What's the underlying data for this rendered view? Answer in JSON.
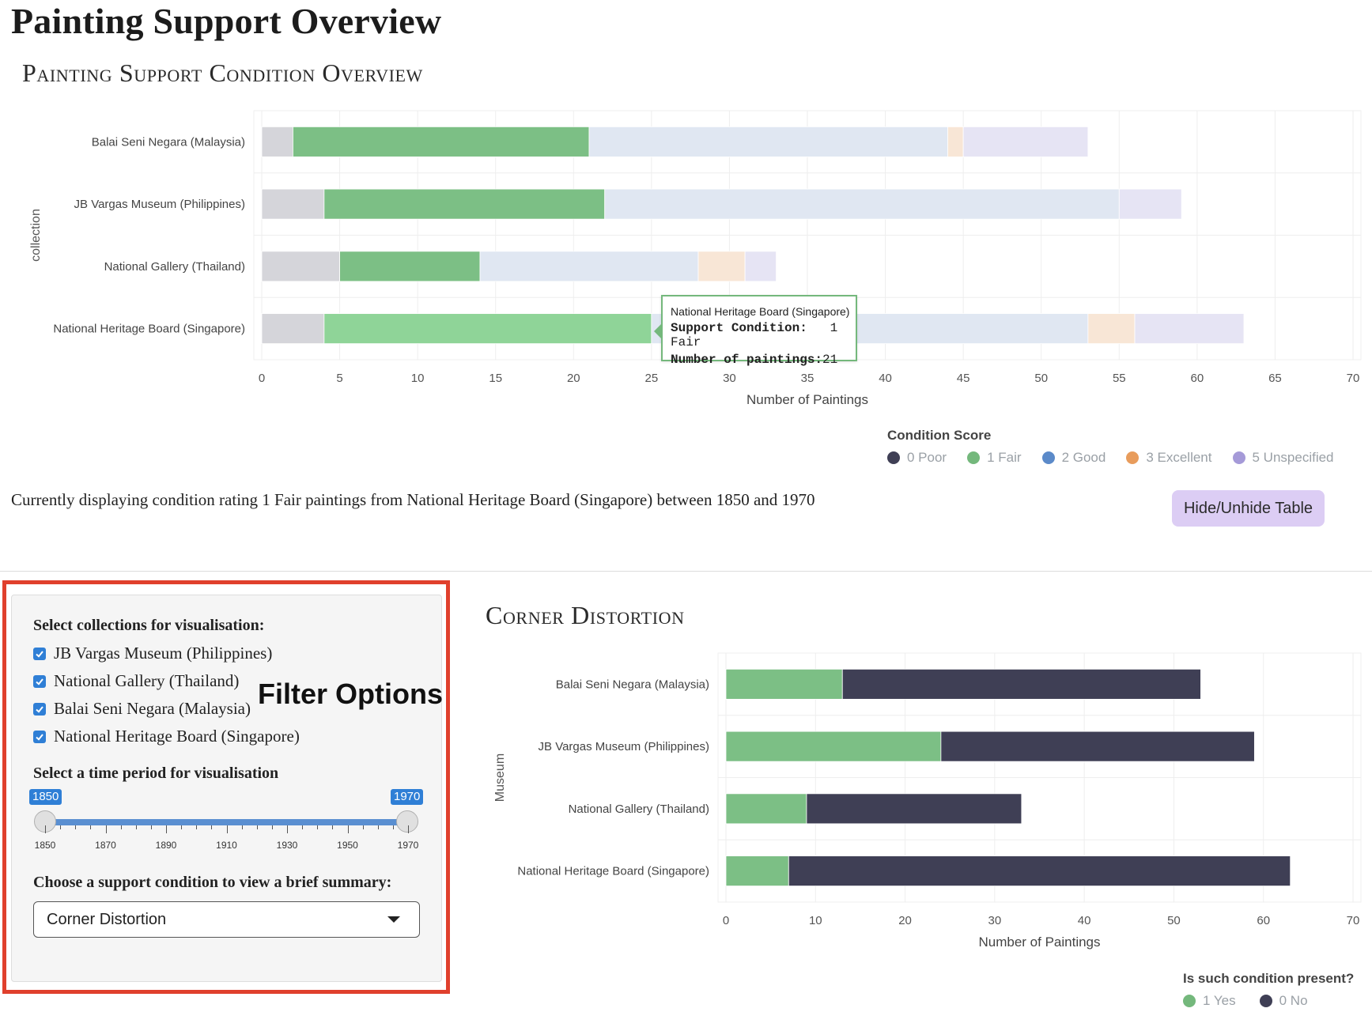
{
  "page_title": "Painting Support Overview",
  "chart1": {
    "title": "Painting Support Condition Overview",
    "tooltip": {
      "title": "National Heritage Board (Singapore)",
      "condition_label": "Support Condition:",
      "condition_value": "1 Fair",
      "count_label": "Number of paintings:",
      "count_value": "21"
    },
    "legend": {
      "title": "Condition Score",
      "items": [
        {
          "label": "0 Poor",
          "color": "#3f3f55"
        },
        {
          "label": "1 Fair",
          "color": "#74b87c"
        },
        {
          "label": "2 Good",
          "color": "#5b8ac9"
        },
        {
          "label": "3 Excellent",
          "color": "#e89c5c"
        },
        {
          "label": "5 Unspecified",
          "color": "#a59ad8"
        }
      ]
    }
  },
  "status_text": "Currently displaying condition rating 1 Fair paintings from National Heritage Board (Singapore) between 1850 and 1970",
  "toggle_button": "Hide/Unhide Table",
  "filters": {
    "annotation": "Filter Options",
    "collections_label": "Select collections for visualisation:",
    "collections": [
      {
        "label": "JB Vargas Museum (Philippines)",
        "checked": true
      },
      {
        "label": "National Gallery (Thailand)",
        "checked": true
      },
      {
        "label": "Balai Seni Negara (Malaysia)",
        "checked": true
      },
      {
        "label": "National Heritage Board (Singapore)",
        "checked": true
      }
    ],
    "period_label": "Select a time period for visualisation",
    "slider": {
      "from": "1850",
      "to": "1970",
      "ticks": [
        "1850",
        "1870",
        "1890",
        "1910",
        "1930",
        "1950",
        "1970"
      ]
    },
    "condition_label": "Choose a support condition to view a brief summary:",
    "condition_selected": "Corner Distortion"
  },
  "chart2": {
    "title": "Corner Distortion",
    "legend": {
      "title": "Is such condition present?",
      "items": [
        {
          "label": "1 Yes",
          "color": "#74b87c"
        },
        {
          "label": "0 No",
          "color": "#3f3f55"
        }
      ]
    }
  },
  "chart_data": [
    {
      "type": "bar",
      "orientation": "horizontal",
      "stacked": true,
      "title": "Painting Support Condition Overview",
      "ylabel": "collection",
      "xlabel": "Number of Paintings",
      "xlim": [
        0,
        70
      ],
      "xticks": [
        0,
        5,
        10,
        15,
        20,
        25,
        30,
        35,
        40,
        45,
        50,
        55,
        60,
        65,
        70
      ],
      "categories": [
        "Balai Seni Negara (Malaysia)",
        "JB Vargas Museum (Philippines)",
        "National Gallery (Thailand)",
        "National Heritage Board (Singapore)"
      ],
      "series": [
        {
          "name": "0 Poor",
          "color": "#d5d5da",
          "values": [
            2,
            4,
            5,
            4
          ]
        },
        {
          "name": "1 Fair",
          "color": "#7cbf85",
          "values": [
            19,
            18,
            9,
            21
          ]
        },
        {
          "name": "2 Good",
          "color": "#e0e7f2",
          "values": [
            23,
            33,
            14,
            28
          ]
        },
        {
          "name": "3 Excellent",
          "color": "#f8e6d6",
          "values": [
            1,
            0,
            3,
            3
          ]
        },
        {
          "name": "5 Unspecified",
          "color": "#e6e4f4",
          "values": [
            8,
            4,
            2,
            7
          ]
        }
      ],
      "highlighted": {
        "category": "National Heritage Board (Singapore)",
        "series": "1 Fair",
        "color": "#8fd498"
      },
      "grid": true,
      "legend_position": "bottom-right"
    },
    {
      "type": "bar",
      "orientation": "horizontal",
      "stacked": true,
      "title": "Corner Distortion",
      "ylabel": "Museum",
      "xlabel": "Number of Paintings",
      "xlim": [
        0,
        70
      ],
      "xticks": [
        0,
        10,
        20,
        30,
        40,
        50,
        60,
        70
      ],
      "categories": [
        "Balai Seni Negara (Malaysia)",
        "JB Vargas Museum (Philippines)",
        "National Gallery (Thailand)",
        "National Heritage Board (Singapore)"
      ],
      "series": [
        {
          "name": "1 Yes",
          "color": "#7cbf85",
          "values": [
            13,
            24,
            9,
            7
          ]
        },
        {
          "name": "0 No",
          "color": "#3f3f55",
          "values": [
            40,
            35,
            24,
            56
          ]
        }
      ],
      "grid": true,
      "legend_position": "bottom-right"
    }
  ]
}
